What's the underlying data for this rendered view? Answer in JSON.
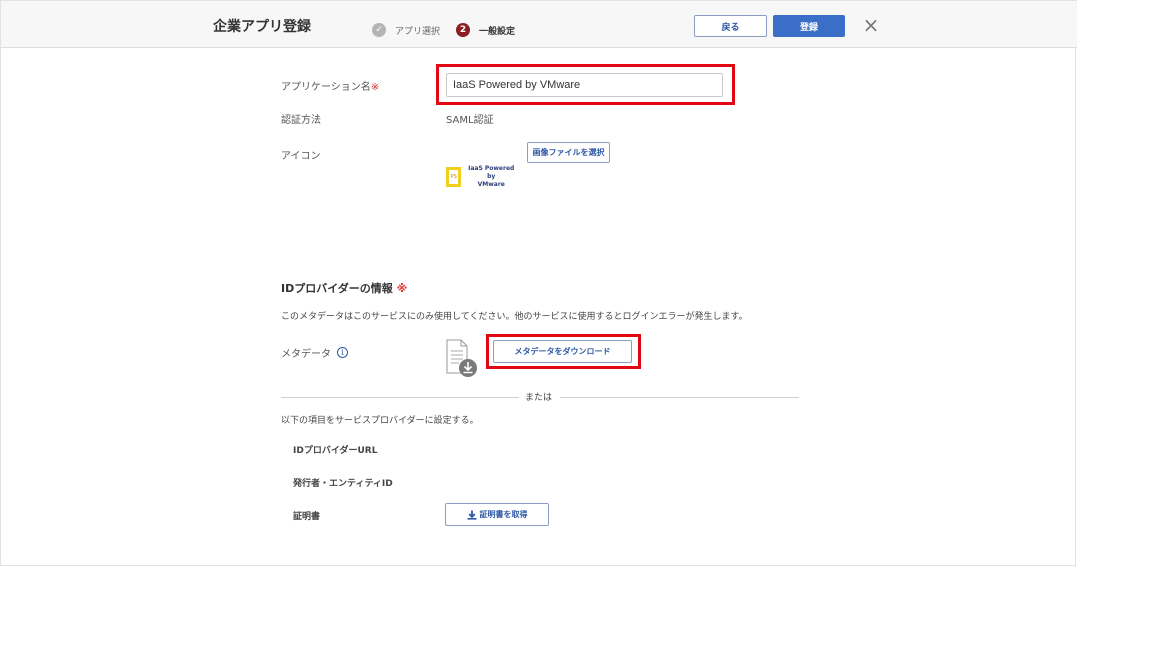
{
  "header": {
    "title": "企業アプリ登録",
    "steps": [
      {
        "label": "アプリ選択",
        "state": "done",
        "marker": "✓"
      },
      {
        "label": "一般設定",
        "state": "current",
        "marker": "2"
      }
    ],
    "back_label": "戻る",
    "register_label": "登録",
    "close_glyph": "×"
  },
  "form": {
    "app_name_label": "アプリケーション名",
    "required_mark": "※",
    "app_name_value": "IaaS Powered by VMware",
    "auth_method_label": "認証方法",
    "auth_method_value": "SAML認証",
    "icon_label": "アイコン",
    "select_image_label": "画像ファイルを選択",
    "icon_preview": {
      "badge": "PS",
      "line1": "IaaS Powered by",
      "line2": "VMware"
    }
  },
  "idp": {
    "title": "IDプロバイダーの情報",
    "required_mark": "※",
    "description": "このメタデータはこのサービスにのみ使用してください。他のサービスに使用するとログインエラーが発生します。",
    "metadata_label": "メタデータ",
    "info_glyph": "i",
    "download_label": "メタデータをダウンロード",
    "or_label": "または",
    "manual_desc": "以下の項目をサービスプロバイダーに設定する。",
    "idp_url_label": "IDプロバイダーURL",
    "issuer_label": "発行者・エンティティID",
    "cert_label": "証明書",
    "get_cert_label": "証明書を取得"
  },
  "colors": {
    "accent": "#3b6fc7",
    "highlight": "#e30613",
    "step_current": "#8b1e22"
  }
}
